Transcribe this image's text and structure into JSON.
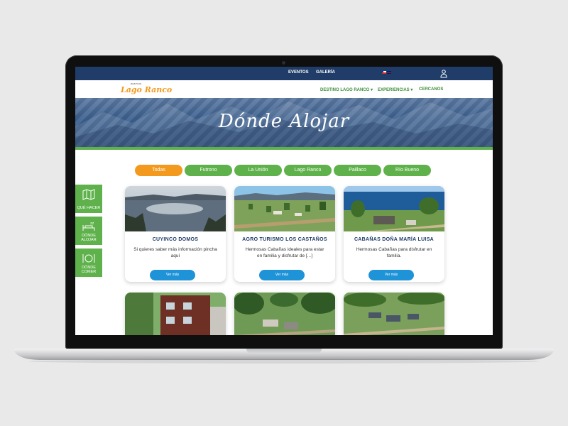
{
  "topbar": {
    "links": [
      "EVENTOS",
      "GALERÍA"
    ]
  },
  "navbar": {
    "logo_small": "DESTINO",
    "logo": "Lago Ranco",
    "items": [
      "DESTINO LAGO RANCO ▾",
      "EXPERIENCIAS ▾",
      "CERCANOS"
    ]
  },
  "hero": {
    "title": "Dónde Alojar"
  },
  "filters": [
    "Todas",
    "Futrono",
    "La Unión",
    "Lago Ranco",
    "Paillaco",
    "Río Bueno"
  ],
  "side_tabs": [
    "QUÉ HACER",
    "DÓNDE ALOJAR",
    "DÓNDE COMER"
  ],
  "cards": [
    {
      "title": "CUYINCO DOMOS",
      "desc": "Si quieres saber más información pincha aquí",
      "button": "Ver más"
    },
    {
      "title": "AGRO TURISMO LOS CASTAÑOS",
      "desc": "Hermosas Cabañas ideales para estar en familia y disfrutar de [...]",
      "button": "Ver más"
    },
    {
      "title": "CABAÑAS DOÑA MARÍA LUISA",
      "desc": "Hermosas Cabañas para disfrutar en familia.",
      "button": "Ver más"
    }
  ],
  "colors": {
    "navy": "#1f3d68",
    "green": "#5fb24b",
    "orange": "#f39a1e",
    "blue": "#1f93d8"
  }
}
